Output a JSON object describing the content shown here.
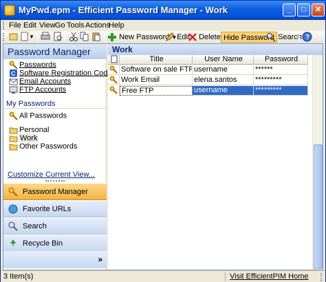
{
  "window": {
    "title": "MyPwd.epm - Efficient Password Manager - Work"
  },
  "menu": [
    "File",
    "Edit",
    "View",
    "Go",
    "Tools",
    "Actions",
    "Help"
  ],
  "toolbar": {
    "new_password": "New Password",
    "edit": "Edit",
    "delete": "Delete",
    "hide_password": "Hide Password",
    "search": "Search"
  },
  "sidebar": {
    "title": "Password Manager",
    "categories": [
      {
        "label": "Passwords",
        "icon": "key-icon"
      },
      {
        "label": "Software Registration Codes",
        "icon": "registration-icon"
      },
      {
        "label": "Email Accounts",
        "icon": "email-icon"
      },
      {
        "label": "FTP Accounts",
        "icon": "ftp-icon"
      }
    ],
    "my_passwords_label": "My Passwords",
    "all_passwords": "All Passwords",
    "folders": [
      "Personal",
      "Work",
      "Other Passwords"
    ],
    "customize": "Customize Current View...",
    "nav": [
      {
        "label": "Password Manager",
        "icon": "key-icon",
        "active": true
      },
      {
        "label": "Favorite URLs",
        "icon": "globe-icon",
        "active": false
      },
      {
        "label": "Search",
        "icon": "search-icon",
        "active": false
      },
      {
        "label": "Recycle Bin",
        "icon": "recycle-icon",
        "active": false
      }
    ],
    "footer_glyph": "»"
  },
  "main": {
    "folder_title": "Work",
    "columns": [
      "Title",
      "User Name",
      "Password"
    ],
    "rows": [
      {
        "title": "Software on sale FTP",
        "user": "username",
        "password": "******",
        "selected": false
      },
      {
        "title": "Work Email",
        "user": "elena.santos",
        "password": "*********",
        "selected": false
      },
      {
        "title": "Free FTP",
        "user": "username",
        "password": "*********",
        "selected": true
      }
    ]
  },
  "status": {
    "items": "3 Item(s)",
    "link": "Visit EfficientPIM Home Page"
  },
  "colors": {
    "selection": "#316ac5",
    "titlebar": "#0552d6",
    "active_nav": "#f4b244"
  }
}
